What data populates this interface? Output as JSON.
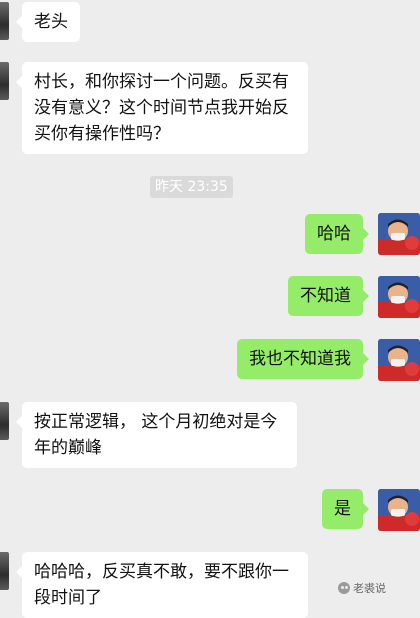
{
  "messages": [
    {
      "side": "left",
      "text": "老头"
    },
    {
      "side": "left",
      "text": "村长，和你探讨一个问题。反买有没有意义？这个时间节点我开始反买你有操作性吗？"
    },
    {
      "side": "right",
      "text": "哈哈"
    },
    {
      "side": "right",
      "text": "不知道"
    },
    {
      "side": "right",
      "text": "我也不知道我"
    },
    {
      "side": "left",
      "text": "按正常逻辑， 这个月初绝对是今年的巅峰"
    },
    {
      "side": "right",
      "text": "是"
    },
    {
      "side": "left",
      "text": "哈哈哈，反买真不敢，要不跟你一段时间了"
    }
  ],
  "timestamp": "昨天 23:35",
  "watermark": "老裘说",
  "colors": {
    "background": "#ededed",
    "bubble_self": "#95ec69",
    "bubble_other": "#ffffff"
  }
}
